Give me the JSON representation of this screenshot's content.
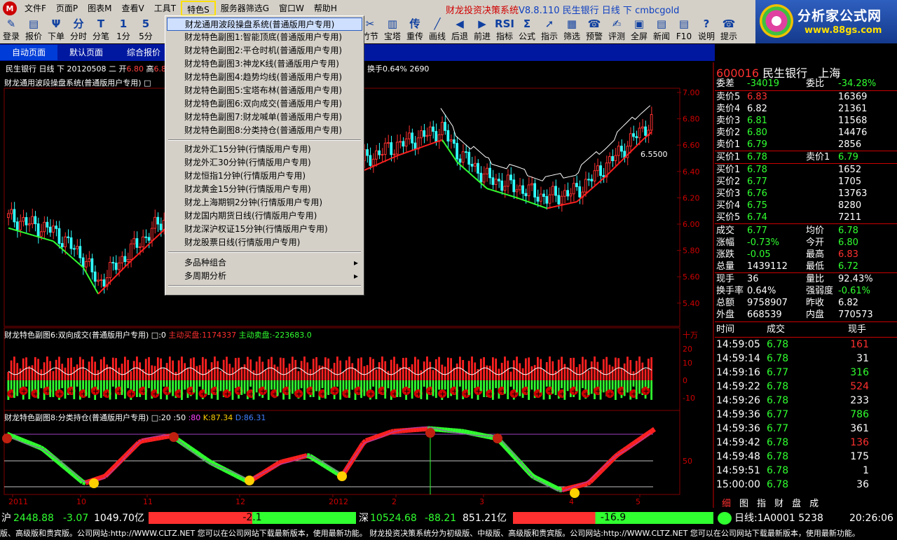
{
  "menubar": {
    "items": [
      "文件F",
      "页面P",
      "图表M",
      "查看V",
      "工具T",
      "特色S",
      "服务器筛选G",
      "窗口W",
      "帮助H"
    ],
    "active": "特色S",
    "app_title": "财龙投资决策系统",
    "version": "V8.8.110",
    "context": "民生银行 日线 下 cmbcgold"
  },
  "brand": {
    "name": "分析家公式网",
    "url": "www.88gs.com"
  },
  "toolbar": [
    {
      "icon": "login-icon",
      "glyph": "✎",
      "label": "登录"
    },
    {
      "icon": "quote-icon",
      "glyph": "▤",
      "label": "报价"
    },
    {
      "icon": "order-icon",
      "glyph": "Ψ",
      "label": "下单"
    },
    {
      "icon": "intraday-icon",
      "glyph": "分",
      "label": "分时"
    },
    {
      "icon": "tick-icon",
      "glyph": "T",
      "label": "分笔"
    },
    {
      "icon": "1min-icon",
      "glyph": "1",
      "label": "1分"
    },
    {
      "icon": "5min-icon",
      "glyph": "5",
      "label": "5分"
    },
    {
      "icon": "b-icon",
      "glyph": "",
      "label": ""
    },
    {
      "icon": "c-icon",
      "glyph": "",
      "label": ""
    },
    {
      "icon": "d-icon",
      "glyph": "",
      "label": ""
    },
    {
      "icon": "e-icon",
      "glyph": "",
      "label": ""
    },
    {
      "icon": "f-icon",
      "glyph": "",
      "label": ""
    },
    {
      "icon": "g-icon",
      "glyph": "",
      "label": ""
    },
    {
      "icon": "h-icon",
      "glyph": "",
      "label": ""
    },
    {
      "icon": "i-icon",
      "glyph": "",
      "label": ""
    },
    {
      "icon": "j-icon",
      "glyph": "",
      "label": ""
    },
    {
      "icon": "k-icon",
      "glyph": "✂",
      "label": "竹节"
    },
    {
      "icon": "tower-icon",
      "glyph": "▥",
      "label": "宝塔"
    },
    {
      "icon": "chip-icon",
      "glyph": "传",
      "label": "重传"
    },
    {
      "icon": "line-icon",
      "glyph": "╱",
      "label": "画线"
    },
    {
      "icon": "back-icon",
      "glyph": "◀",
      "label": "后退"
    },
    {
      "icon": "forward-icon",
      "glyph": "▶",
      "label": "前进"
    },
    {
      "icon": "indicator-icon",
      "glyph": "RSI",
      "label": "指标"
    },
    {
      "icon": "formula-icon",
      "glyph": "Σ",
      "label": "公式"
    },
    {
      "icon": "guide-icon",
      "glyph": "➚",
      "label": "指示"
    },
    {
      "icon": "filter-icon",
      "glyph": "▦",
      "label": "筛选"
    },
    {
      "icon": "alarm-icon",
      "glyph": "☎",
      "label": "预警"
    },
    {
      "icon": "evaluate-icon",
      "glyph": "✍",
      "label": "评测"
    },
    {
      "icon": "fullscreen-icon",
      "glyph": "▣",
      "label": "全屏"
    },
    {
      "icon": "news-icon",
      "glyph": "▤",
      "label": "新闻"
    },
    {
      "icon": "f10-icon",
      "glyph": "▤",
      "label": "F10"
    },
    {
      "icon": "help-icon",
      "glyph": "?",
      "label": "说明"
    },
    {
      "icon": "tip-icon",
      "glyph": "☎",
      "label": "提示"
    }
  ],
  "tabs": [
    "自动页面",
    "默认页面",
    "综合报价"
  ],
  "chart_header": {
    "stock": "民生银行",
    "period": "日线",
    "dir": "下",
    "date": "20120508",
    "weekday": "二",
    "open_label": "开",
    "open": "6.80",
    "high_label": "高",
    "high": "6.8",
    "turnover": "换手0.64% 2690"
  },
  "panels": {
    "main_name": "财龙通用波段操盘系统(普通版用户专用)",
    "sub1_name": "财龙特色副图6:双向成交(普通版用户专用)",
    "sub1_params": "□:0",
    "sub1_buy_label": "主动买盘:1174337",
    "sub1_sell_label": "主动卖盘:-223683.0",
    "sub2_name": "财龙特色副图8:分类持仓(普通版用户专用)",
    "sub2_params": "□:20 :50",
    "sub2_p80": ":80",
    "sub2_k": "K:87.34",
    "sub2_d": "D:86.31",
    "annotation": "6.5500",
    "y_ticks_main": [
      "7.00",
      "6.80",
      "6.60",
      "6.40",
      "6.20",
      "6.00",
      "5.80",
      "5.60",
      "5.40"
    ],
    "y_ticks_sub1": [
      "十万",
      "20",
      "10",
      "0",
      "-10"
    ],
    "y_ticks_sub2": [
      "50"
    ],
    "x_ticks": [
      "2011",
      "10",
      "11",
      "12",
      "2012",
      "2",
      "3",
      "4",
      "5"
    ]
  },
  "quote": {
    "code": "600016",
    "name": "民生银行",
    "market": "上海",
    "weicha_label": "委差",
    "weicha": "-34019",
    "weibi_label": "委比",
    "weibi": "-34.28%",
    "asks": [
      {
        "label": "卖价5",
        "price": "6.83",
        "vol": "16369"
      },
      {
        "label": "卖价4",
        "price": "6.82",
        "vol": "21361"
      },
      {
        "label": "卖价3",
        "price": "6.81",
        "vol": "11568"
      },
      {
        "label": "卖价2",
        "price": "6.80",
        "vol": "14476"
      },
      {
        "label": "卖价1",
        "price": "6.79",
        "vol": "2856"
      }
    ],
    "mid_buy_label": "买价1",
    "mid_buy": "6.78",
    "mid_sell_label": "卖价1",
    "mid_sell": "6.79",
    "bids": [
      {
        "label": "买价1",
        "price": "6.78",
        "vol": "1652"
      },
      {
        "label": "买价2",
        "price": "6.77",
        "vol": "1705"
      },
      {
        "label": "买价3",
        "price": "6.76",
        "vol": "13763"
      },
      {
        "label": "买价4",
        "price": "6.75",
        "vol": "8280"
      },
      {
        "label": "买价5",
        "price": "6.74",
        "vol": "7211"
      }
    ],
    "stats": [
      {
        "l1": "成交",
        "v1": "6.77",
        "c1": "gr",
        "l2": "均价",
        "v2": "6.78",
        "c2": "gr"
      },
      {
        "l1": "涨幅",
        "v1": "-0.73%",
        "c1": "gr",
        "l2": "今开",
        "v2": "6.80",
        "c2": "gr"
      },
      {
        "l1": "涨跌",
        "v1": "-0.05",
        "c1": "gr",
        "l2": "最高",
        "v2": "6.83",
        "c2": "rd"
      },
      {
        "l1": "总量",
        "v1": "1439112",
        "c1": "wh",
        "l2": "最低",
        "v2": "6.72",
        "c2": "gr"
      },
      {
        "l1": "现手",
        "v1": "36",
        "c1": "wh",
        "l2": "量比",
        "v2": "92.43%",
        "c2": "wh"
      },
      {
        "l1": "换手率",
        "v1": "0.64%",
        "c1": "wh",
        "l2": "强弱度",
        "v2": "-0.61%",
        "c2": "gr"
      },
      {
        "l1": "总额",
        "v1": "9758907",
        "c1": "wh",
        "l2": "昨收",
        "v2": "6.82",
        "c2": "wh"
      },
      {
        "l1": "外盘",
        "v1": "668539",
        "c1": "wh",
        "l2": "内盘",
        "v2": "770573",
        "c2": "wh"
      }
    ],
    "tick_headers": [
      "时间",
      "成交",
      "现手"
    ],
    "ticks": [
      {
        "t": "14:59:05",
        "p": "6.78",
        "v": "161",
        "vc": "rd"
      },
      {
        "t": "14:59:14",
        "p": "6.78",
        "v": "31",
        "vc": "wh"
      },
      {
        "t": "14:59:16",
        "p": "6.77",
        "v": "316",
        "vc": "gr"
      },
      {
        "t": "14:59:22",
        "p": "6.78",
        "v": "524",
        "vc": "rd"
      },
      {
        "t": "14:59:26",
        "p": "6.78",
        "v": "233",
        "vc": "wh"
      },
      {
        "t": "14:59:36",
        "p": "6.77",
        "v": "786",
        "vc": "gr"
      },
      {
        "t": "14:59:36",
        "p": "6.77",
        "v": "361",
        "vc": "wh"
      },
      {
        "t": "14:59:42",
        "p": "6.78",
        "v": "136",
        "vc": "rd"
      },
      {
        "t": "14:59:48",
        "p": "6.78",
        "v": "175",
        "vc": "wh"
      },
      {
        "t": "14:59:51",
        "p": "6.78",
        "v": "1",
        "vc": "wh"
      },
      {
        "t": "15:00:00",
        "p": "6.78",
        "v": "36",
        "vc": "wh"
      }
    ],
    "bottom_tabs": [
      "细",
      "图",
      "指",
      "财",
      "盘",
      "成"
    ]
  },
  "status": {
    "sh_label": "沪",
    "sh_index": "2448.88",
    "sh_change": "-3.07",
    "sh_amount": "1049.70亿",
    "sh_bar": "-2.1",
    "sz_label": "深",
    "sz_index": "10524.68",
    "sz_change": "-88.21",
    "sz_amount": "851.21亿",
    "sz_bar": "-16.9",
    "line_label": "日线:1A0001 5238",
    "time": "20:26:06"
  },
  "ticker": "版、高级版和贵宾版。公司网站:http://WWW.CLTZ.NET   您可以在公司网站下载最新版本，使用最新功能。    财龙投资决策系统分为初级版、中级版、高级版和贵宾版。公司网站:http://WWW.CLTZ.NET   您可以在公司网站下载最新版本，使用最新功能。",
  "dropdown": {
    "group1": [
      "财龙通用波段操盘系统(普通版用户专用)",
      "财龙特色副图1:智能顶底(普通版用户专用)",
      "财龙特色副图2:平仓时机(普通版用户专用)",
      "财龙特色副图3:神龙K线(普通版用户专用)",
      "财龙特色副图4:趋势均线(普通版用户专用)",
      "财龙特色副图5:宝塔布林(普通版用户专用)",
      "财龙特色副图6:双向成交(普通版用户专用)",
      "财龙特色副图7:财龙喊单(普通版用户专用)",
      "财龙特色副图8:分类持仓(普通版用户专用)"
    ],
    "group2": [
      "财龙外汇15分钟(行情版用户专用)",
      "财龙外汇30分钟(行情版用户专用)",
      "财龙恒指1分钟(行情版用户专用)",
      "财龙黄金15分钟(行情版用户专用)",
      "财龙上海期铜2分钟(行情版用户专用)",
      "财龙国内期货日线(行情版用户专用)",
      "财龙深沪权证15分钟(行情版用户专用)",
      "财龙股票日线(行情版用户专用)"
    ],
    "group3": [
      "多品种组合",
      "多周期分析"
    ],
    "last": "____"
  },
  "colors": {
    "up": "#ff3030",
    "down": "#30ffff",
    "ma_up": "#ff2020",
    "ma_down": "#30ff30",
    "grid": "#800000"
  }
}
